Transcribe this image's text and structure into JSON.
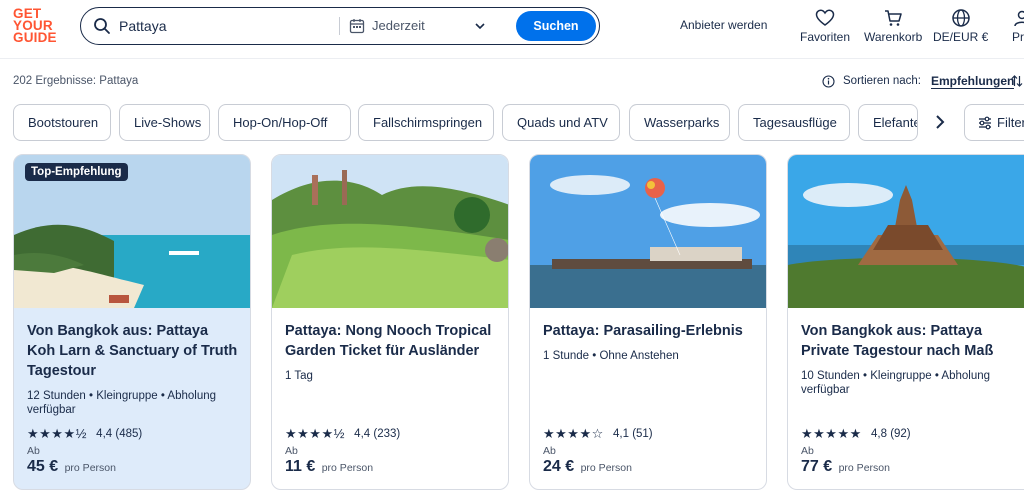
{
  "brand": {
    "logo_lines": [
      "GET",
      "YOUR",
      "GUIDE"
    ],
    "accent_color": "#ff5533",
    "primary_color": "#0071eb"
  },
  "search": {
    "query": "Pattaya",
    "date_label": "Jederzeit",
    "button_label": "Suchen"
  },
  "header": {
    "supplier_link": "Anbieter werden",
    "nav": [
      {
        "label": "Favoriten",
        "icon": "heart-icon"
      },
      {
        "label": "Warenkorb",
        "icon": "cart-icon"
      },
      {
        "label": "DE/EUR €",
        "icon": "globe-icon"
      },
      {
        "label": "Pr",
        "icon": "profile-icon"
      }
    ]
  },
  "results": {
    "count_text": "202 Ergebnisse: Pattaya",
    "sort_label": "Sortieren nach:",
    "sort_value": "Empfehlungen"
  },
  "chips": [
    "Bootstouren",
    "Live-Shows",
    "Hop-On/Hop-Off",
    "Fallschirmspringen",
    "Quads und ATV",
    "Wasserparks",
    "Tagesausflüge",
    "Elefanten"
  ],
  "filter_label": "Filter",
  "cards": [
    {
      "badge": "Top-Empfehlung",
      "title": "Von Bangkok aus: Pattaya Koh Larn & Sanctuary of Truth Tagestour",
      "meta": "12 Stunden • Kleingruppe • Abholung verfügbar",
      "stars": "★★★★½",
      "stars_value": 4.4,
      "rating": "4,4",
      "reviews": "(485)",
      "ab": "Ab",
      "price": "45 €",
      "per": "pro Person",
      "selected": true
    },
    {
      "badge": "",
      "title": "Pattaya: Nong Nooch Tropical Garden Ticket für Ausländer",
      "meta": "1 Tag",
      "stars": "★★★★½",
      "stars_value": 4.4,
      "rating": "4,4",
      "reviews": "(233)",
      "ab": "Ab",
      "price": "11 €",
      "per": "pro Person",
      "selected": false
    },
    {
      "badge": "",
      "title": "Pattaya: Parasailing-Erlebnis",
      "meta": "1 Stunde • Ohne Anstehen",
      "stars": "★★★★☆",
      "stars_value": 4.1,
      "rating": "4,1",
      "reviews": "(51)",
      "ab": "Ab",
      "price": "24 €",
      "per": "pro Person",
      "selected": false
    },
    {
      "badge": "",
      "title": "Von Bangkok aus: Pattaya Private Tagestour nach Maß",
      "meta": "10 Stunden • Kleingruppe • Abholung verfügbar",
      "stars": "★★★★★",
      "stars_value": 4.8,
      "rating": "4,8",
      "reviews": "(92)",
      "ab": "Ab",
      "price": "77 €",
      "per": "pro Person",
      "selected": false
    }
  ]
}
